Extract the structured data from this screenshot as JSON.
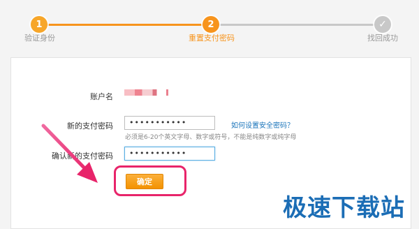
{
  "steps": [
    {
      "number": "1",
      "label": "验证身份"
    },
    {
      "number": "2",
      "label": "重置支付密码"
    },
    {
      "number": "✓",
      "label": "找回成功"
    }
  ],
  "form": {
    "account_label": "账户名",
    "new_password_label": "新的支付密码",
    "new_password_value": "•••••••••••",
    "help_link": "如何设置安全密码？",
    "hint": "必须是6-20个英文字母、数字或符号，不能是纯数字或纯字母",
    "confirm_label": "确认新的支付密码",
    "confirm_password_value": "•••••••••••",
    "submit_label": "确定"
  },
  "colors": {
    "accent": "#f7941d",
    "inactive": "#c8c8c8",
    "link": "#1b75bb",
    "highlight": "#e8246a"
  },
  "watermark": "极速下载站"
}
